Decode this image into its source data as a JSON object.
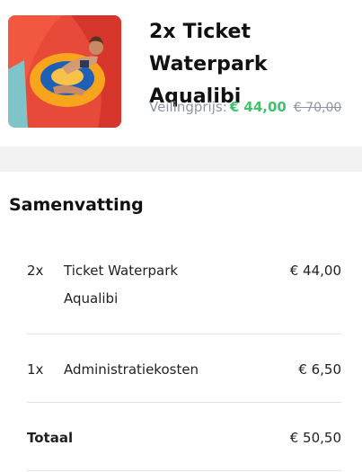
{
  "product": {
    "image_alt": "waterpark-slide-photo",
    "title": "2x Ticket Waterpark Aqualibi",
    "price_label": "Veilingprijs:",
    "price_now": "€ 44,00",
    "price_old": "€ 70,00"
  },
  "summary": {
    "title": "Samenvatting",
    "items": [
      {
        "qty": "2x",
        "name": "Ticket Waterpark Aqualibi",
        "amount": "€ 44,00"
      },
      {
        "qty": "1x",
        "name": "Administratiekosten",
        "amount": "€ 6,50"
      }
    ],
    "total_label": "Totaal",
    "total_amount": "€ 50,50"
  },
  "colors": {
    "accent_green": "#3dc46a",
    "muted_gray": "#8b95a3",
    "band": "#f2f2f2"
  }
}
